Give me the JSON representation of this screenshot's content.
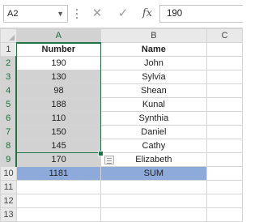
{
  "formula_bar": {
    "name_box": "A2",
    "cancel_glyph": "✕",
    "enter_glyph": "✓",
    "fx_label": "fx",
    "formula_value": "190"
  },
  "columns": [
    "A",
    "B",
    "C"
  ],
  "rows": [
    {
      "num": "1",
      "a": "Number",
      "b": "Name"
    },
    {
      "num": "2",
      "a": "190",
      "b": "John"
    },
    {
      "num": "3",
      "a": "130",
      "b": "Sylvia"
    },
    {
      "num": "4",
      "a": "98",
      "b": "Shean"
    },
    {
      "num": "5",
      "a": "188",
      "b": "Kunal"
    },
    {
      "num": "6",
      "a": "110",
      "b": "Synthia"
    },
    {
      "num": "7",
      "a": "150",
      "b": "Daniel"
    },
    {
      "num": "8",
      "a": "145",
      "b": "Cathy"
    },
    {
      "num": "9",
      "a": "170",
      "b": "Elizabeth"
    },
    {
      "num": "10",
      "a": "1181",
      "b": "SUM"
    },
    {
      "num": "11",
      "a": "",
      "b": ""
    },
    {
      "num": "12",
      "a": "",
      "b": ""
    },
    {
      "num": "13",
      "a": "",
      "b": ""
    }
  ],
  "colors": {
    "selection_green": "#217346",
    "selected_fill": "#d2d2d2",
    "sum_row_fill": "#8eaadb"
  }
}
